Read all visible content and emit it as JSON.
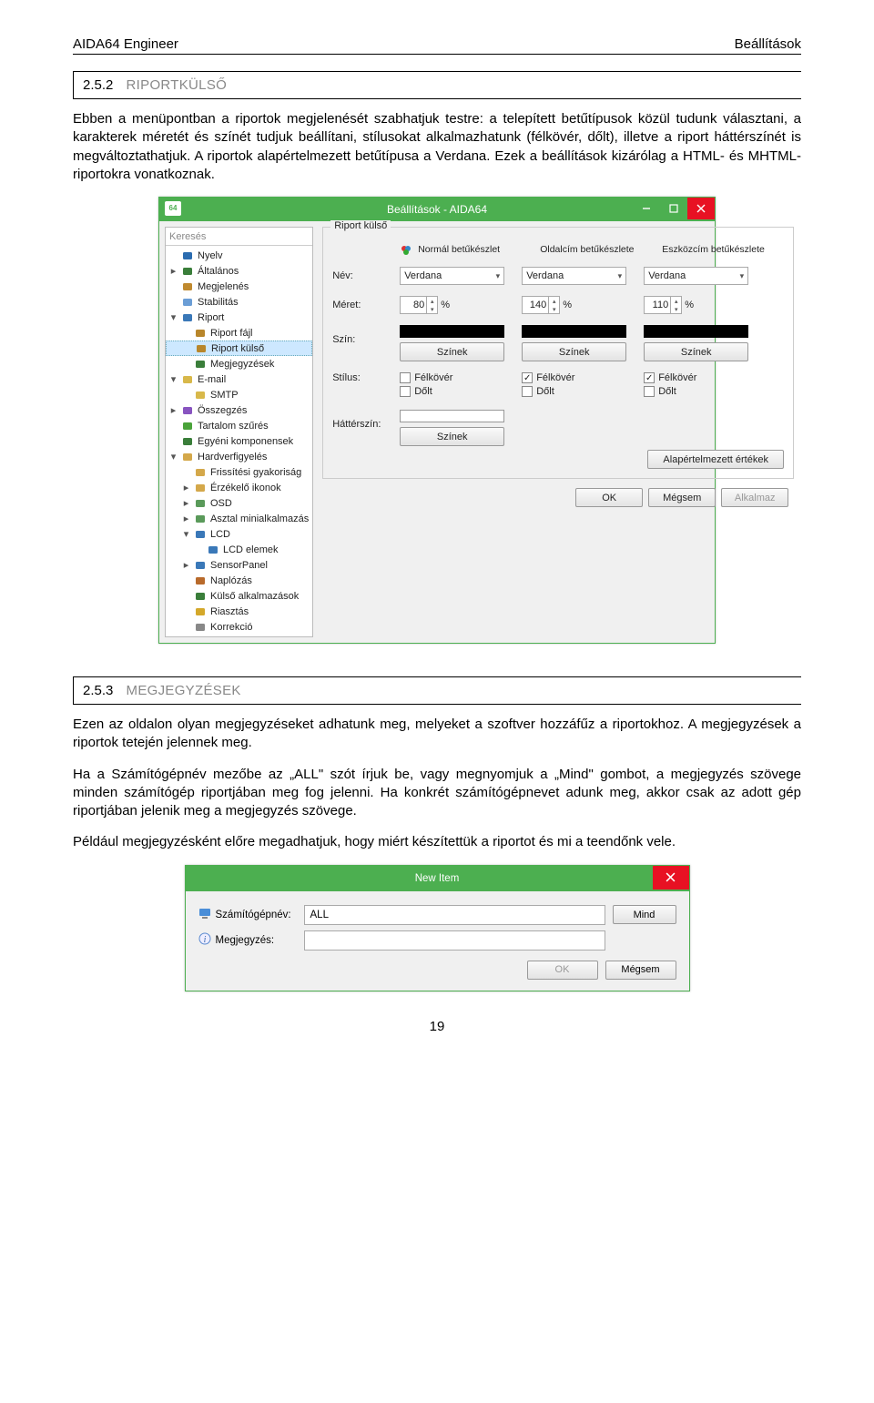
{
  "header": {
    "left": "AIDA64 Engineer",
    "right": "Beállítások"
  },
  "section1": {
    "num": "2.5.2",
    "title": "RIPORTKÜLSŐ"
  },
  "para1": "Ebben a menüpontban a riportok megjelenését szabhatjuk testre: a telepített betűtípusok közül tudunk választani, a karakterek méretét és színét tudjuk beállítani, stílusokat alkalmazhatunk (félkövér, dőlt), illetve a riport háttérszínét is megváltoztathatjuk. A riportok alapértelmezett betűtípusa a Verdana. Ezek a beállítások kizárólag a HTML- és MHTML-riportokra vonatkoznak.",
  "prefs": {
    "window_title": "Beállítások - AIDA64",
    "search_placeholder": "Keresés",
    "tree": [
      {
        "label": "Nyelv",
        "level": 0,
        "caret": "",
        "clr": "#2b6cb0"
      },
      {
        "label": "Általános",
        "level": 0,
        "caret": "▸",
        "clr": "#3a7e3a"
      },
      {
        "label": "Megjelenés",
        "level": 0,
        "caret": "",
        "clr": "#c08a2f"
      },
      {
        "label": "Stabilitás",
        "level": 0,
        "caret": "",
        "clr": "#6b9ed6"
      },
      {
        "label": "Riport",
        "level": 0,
        "caret": "▾",
        "clr": "#3a78b8"
      },
      {
        "label": "Riport fájl",
        "level": 1,
        "caret": "",
        "clr": "#b8862b",
        "sel": false
      },
      {
        "label": "Riport külső",
        "level": 1,
        "caret": "",
        "clr": "#b8862b",
        "sel": true
      },
      {
        "label": "Megjegyzések",
        "level": 1,
        "caret": "",
        "clr": "#3a7e3a"
      },
      {
        "label": "E-mail",
        "level": 0,
        "caret": "▾",
        "clr": "#d8b84a"
      },
      {
        "label": "SMTP",
        "level": 1,
        "caret": "",
        "clr": "#d8b84a"
      },
      {
        "label": "Összegzés",
        "level": 0,
        "caret": "▸",
        "clr": "#8854c0"
      },
      {
        "label": "Tartalom szűrés",
        "level": 0,
        "caret": "",
        "clr": "#4aa33a"
      },
      {
        "label": "Egyéni komponensek",
        "level": 0,
        "caret": "",
        "clr": "#3a7e3a"
      },
      {
        "label": "Hardverfigyelés",
        "level": 0,
        "caret": "▾",
        "clr": "#d4a84a"
      },
      {
        "label": "Frissítési gyakoriság",
        "level": 1,
        "caret": "",
        "clr": "#d4a84a"
      },
      {
        "label": "Érzékelő ikonok",
        "level": 1,
        "caret": "▸",
        "clr": "#d4a84a"
      },
      {
        "label": "OSD",
        "level": 1,
        "caret": "▸",
        "clr": "#5a9a5a"
      },
      {
        "label": "Asztal minialkalmazás",
        "level": 1,
        "caret": "▸",
        "clr": "#5a9a5a"
      },
      {
        "label": "LCD",
        "level": 1,
        "caret": "▾",
        "clr": "#3a78b8"
      },
      {
        "label": "LCD elemek",
        "level": 2,
        "caret": "",
        "clr": "#3a78b8"
      },
      {
        "label": "SensorPanel",
        "level": 1,
        "caret": "▸",
        "clr": "#3a78b8"
      },
      {
        "label": "Naplózás",
        "level": 1,
        "caret": "",
        "clr": "#b86a2b"
      },
      {
        "label": "Külső alkalmazások",
        "level": 1,
        "caret": "",
        "clr": "#3a7e3a"
      },
      {
        "label": "Riasztás",
        "level": 1,
        "caret": "",
        "clr": "#d4a82a"
      },
      {
        "label": "Korrekció",
        "level": 1,
        "caret": "",
        "clr": "#888"
      }
    ],
    "group_label": "Riport külső",
    "cols": [
      "Normál betűkészlet",
      "Oldalcím betűkészlete",
      "Eszközcím betűkészlete"
    ],
    "rows": {
      "name_label": "Név:",
      "names": [
        "Verdana",
        "Verdana",
        "Verdana"
      ],
      "size_label": "Méret:",
      "sizes": [
        "80",
        "140",
        "110"
      ],
      "pct": "%",
      "color_label": "Szín:",
      "colors_btn": "Színek",
      "style_label": "Stílus:",
      "bold_label": "Félkövér",
      "italic_label": "Dőlt",
      "bold_checked": [
        false,
        true,
        true
      ],
      "italic_checked": [
        false,
        false,
        false
      ]
    },
    "bg_label": "Háttérszín:",
    "bg_btn": "Színek",
    "defaults_btn": "Alapértelmezett értékek",
    "footer": {
      "ok": "OK",
      "cancel": "Mégsem",
      "apply": "Alkalmaz"
    }
  },
  "section2": {
    "num": "2.5.3",
    "title": "MEGJEGYZÉSEK"
  },
  "para2": "Ezen az oldalon olyan megjegyzéseket adhatunk meg, melyeket a szoftver hozzáfűz a riportokhoz. A megjegyzések a riportok tetején jelennek meg.",
  "para3": "Ha a Számítógépnév mezőbe az „ALL\" szót írjuk be, vagy megnyomjuk a „Mind\" gombot, a megjegyzés szövege minden számítógép riportjában meg fog jelenni. Ha konkrét számítógépnevet adunk meg, akkor csak az adott gép riportjában jelenik meg a megjegyzés szövege.",
  "para4": "Például megjegyzésként előre megadhatjuk, hogy miért készítettük a riportot és mi a teendőnk vele.",
  "newitem": {
    "title": "New Item",
    "pc_label": "Számítógépnév:",
    "pc_value": "ALL",
    "all_btn": "Mind",
    "note_label": "Megjegyzés:",
    "note_value": "",
    "ok": "OK",
    "cancel": "Mégsem"
  },
  "page_number": "19"
}
